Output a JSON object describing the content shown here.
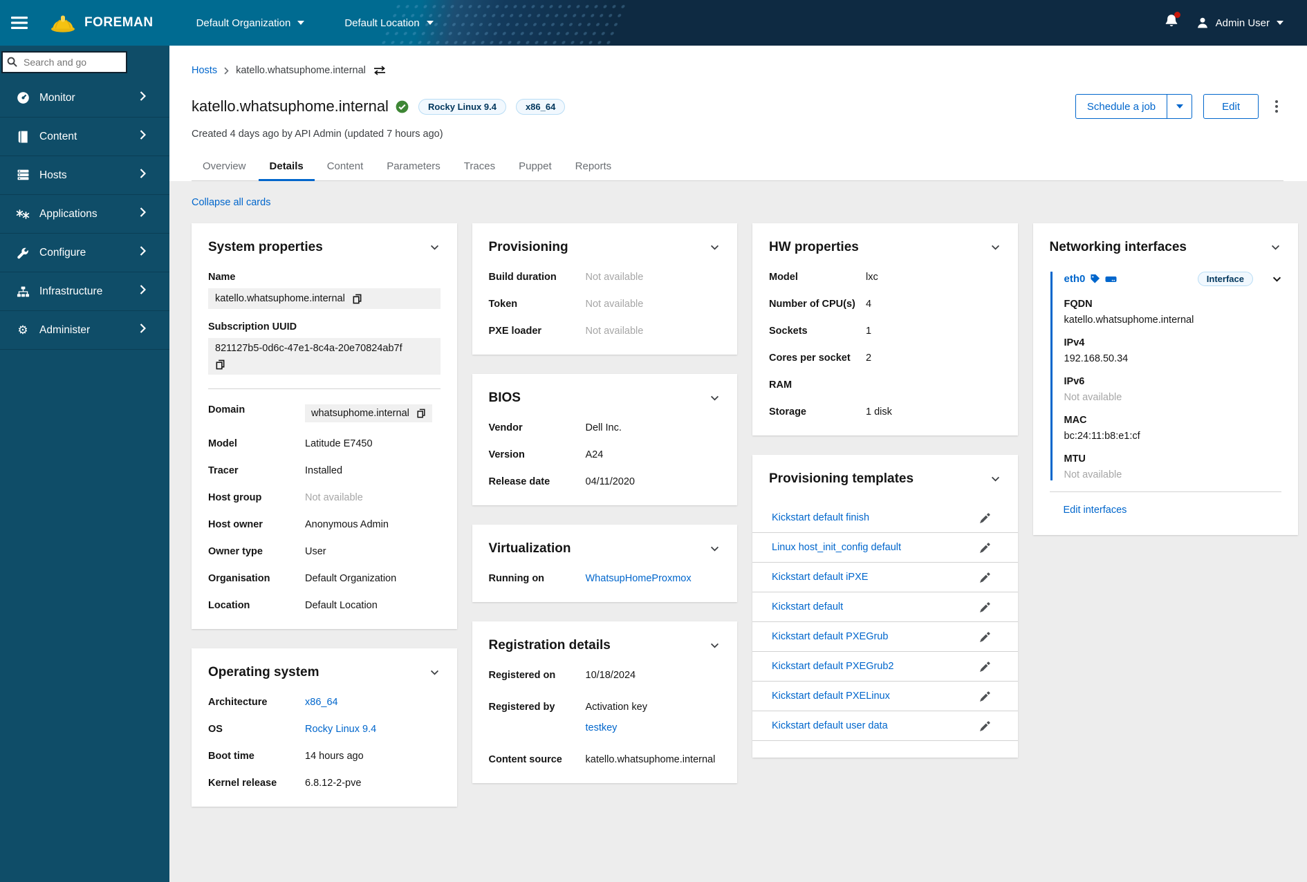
{
  "masthead": {
    "brand": "FOREMAN",
    "org_selector": "Default Organization",
    "loc_selector": "Default Location",
    "user_name": "Admin User"
  },
  "sidebar": {
    "search_placeholder": "Search and go",
    "items": [
      {
        "label": "Monitor"
      },
      {
        "label": "Content"
      },
      {
        "label": "Hosts"
      },
      {
        "label": "Applications"
      },
      {
        "label": "Configure"
      },
      {
        "label": "Infrastructure"
      },
      {
        "label": "Administer"
      }
    ]
  },
  "breadcrumb": {
    "hosts": "Hosts",
    "current": "katello.whatsuphome.internal"
  },
  "host_header": {
    "title": "katello.whatsuphome.internal",
    "os_badge": "Rocky Linux 9.4",
    "arch_badge": "x86_64",
    "subtitle": "Created 4 days ago by API Admin (updated 7 hours ago)",
    "schedule_job_label": "Schedule a job",
    "edit_label": "Edit"
  },
  "tabs": [
    "Overview",
    "Details",
    "Content",
    "Parameters",
    "Traces",
    "Puppet",
    "Reports"
  ],
  "active_tab": "Details",
  "collapse_all_label": "Collapse all cards",
  "cards": {
    "system_properties": {
      "title": "System properties",
      "name_label": "Name",
      "name_value": "katello.whatsuphome.internal",
      "uuid_label": "Subscription UUID",
      "uuid_value": "821127b5-0d6c-47e1-8c4a-20e70824ab7f",
      "rows": [
        {
          "label": "Domain",
          "value": "whatsuphome.internal"
        },
        {
          "label": "Model",
          "value": "Latitude E7450"
        },
        {
          "label": "Tracer",
          "value": "Installed"
        },
        {
          "label": "Host group",
          "value": "Not available"
        },
        {
          "label": "Host owner",
          "value": "Anonymous Admin"
        },
        {
          "label": "Owner type",
          "value": "User"
        },
        {
          "label": "Organisation",
          "value": "Default Organization"
        },
        {
          "label": "Location",
          "value": "Default Location"
        }
      ]
    },
    "provisioning": {
      "title": "Provisioning",
      "rows": [
        {
          "label": "Build duration",
          "value": "Not available"
        },
        {
          "label": "Token",
          "value": "Not available"
        },
        {
          "label": "PXE loader",
          "value": "Not available"
        }
      ]
    },
    "bios": {
      "title": "BIOS",
      "rows": [
        {
          "label": "Vendor",
          "value": "Dell Inc."
        },
        {
          "label": "Version",
          "value": "A24"
        },
        {
          "label": "Release date",
          "value": "04/11/2020"
        }
      ]
    },
    "virtualization": {
      "title": "Virtualization",
      "running_on_label": "Running on",
      "running_on_value": "WhatsupHomeProxmox"
    },
    "registration": {
      "title": "Registration details",
      "registered_on_label": "Registered on",
      "registered_on_value": "10/18/2024",
      "registered_by_label": "Registered by",
      "registered_by_value": "Activation key",
      "activation_key": "testkey",
      "content_source_label": "Content source",
      "content_source_value": "katello.whatsuphome.internal"
    },
    "operating_system": {
      "title": "Operating system",
      "rows": [
        {
          "label": "Architecture",
          "value": "x86_64"
        },
        {
          "label": "OS",
          "value": "Rocky Linux 9.4"
        },
        {
          "label": "Boot time",
          "value": "14 hours ago"
        },
        {
          "label": "Kernel release",
          "value": "6.8.12-2-pve"
        }
      ]
    },
    "hw_properties": {
      "title": "HW properties",
      "rows": [
        {
          "label": "Model",
          "value": "lxc"
        },
        {
          "label": "Number of CPU(s)",
          "value": "4"
        },
        {
          "label": "Sockets",
          "value": "1"
        },
        {
          "label": "Cores per socket",
          "value": "2"
        },
        {
          "label": "RAM",
          "value": ""
        },
        {
          "label": "Storage",
          "value": "1 disk"
        }
      ]
    },
    "provisioning_templates": {
      "title": "Provisioning templates",
      "templates": [
        "Kickstart default finish",
        "Linux host_init_config default",
        "Kickstart default iPXE",
        "Kickstart default",
        "Kickstart default PXEGrub",
        "Kickstart default PXEGrub2",
        "Kickstart default PXELinux",
        "Kickstart default user data"
      ]
    },
    "networking": {
      "title": "Networking interfaces",
      "interface_name": "eth0",
      "interface_badge": "Interface",
      "fields": [
        {
          "label": "FQDN",
          "value": "katello.whatsuphome.internal"
        },
        {
          "label": "IPv4",
          "value": "192.168.50.34"
        },
        {
          "label": "IPv6",
          "value": "Not available"
        },
        {
          "label": "MAC",
          "value": "bc:24:11:b8:e1:cf"
        },
        {
          "label": "MTU",
          "value": "Not available"
        }
      ],
      "edit_link": "Edit interfaces"
    }
  },
  "colors": {
    "primary_blue": "#0066cc",
    "masthead_teal": "#006b91",
    "masthead_dark": "#0e2a42",
    "sidebar_bg": "#0f4d68",
    "success_green": "#3e8635",
    "content_bg": "#ededed",
    "notification_red": "#c9190b",
    "brand_yellow": "#f5c211"
  }
}
